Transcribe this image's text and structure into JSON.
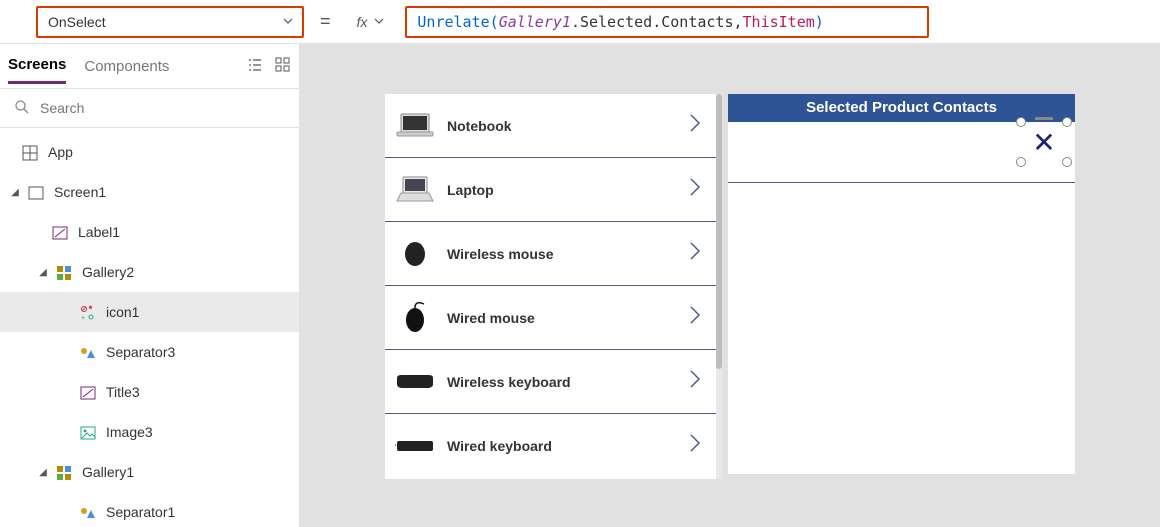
{
  "topbar": {
    "property": "OnSelect",
    "equals": "=",
    "fx_label": "fx"
  },
  "formula": {
    "func": "Unrelate",
    "open": "( ",
    "ident1": "Gallery1",
    "dot1": ".Selected.Contacts",
    "comma": ", ",
    "thisitem": "ThisItem",
    "close": " )"
  },
  "panel": {
    "tabs": {
      "screens": "Screens",
      "components": "Components"
    },
    "search_placeholder": "Search"
  },
  "tree": {
    "app": "App",
    "screen1": "Screen1",
    "label1": "Label1",
    "gallery2": "Gallery2",
    "icon1": "icon1",
    "separator3": "Separator3",
    "title3": "Title3",
    "image3": "Image3",
    "gallery1": "Gallery1",
    "separator1": "Separator1"
  },
  "canvas": {
    "products": [
      "Notebook",
      "Laptop",
      "Wireless mouse",
      "Wired mouse",
      "Wireless keyboard",
      "Wired keyboard"
    ],
    "contacts_header": "Selected Product Contacts"
  }
}
